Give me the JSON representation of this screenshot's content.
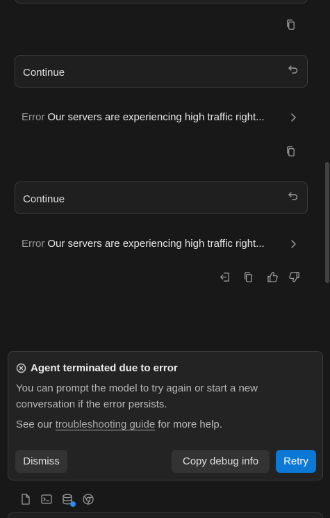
{
  "messages": [
    {
      "user_text": "Continue",
      "error_label": "Error",
      "error_text": "Our servers are experiencing high traffic right..."
    },
    {
      "user_text": "Continue",
      "error_label": "Error",
      "error_text": "Our servers are experiencing high traffic right..."
    }
  ],
  "icons": {
    "copy": "copy-icon",
    "undo": "undo-icon",
    "chevron": "chevron-right-icon",
    "export": "export-icon",
    "thumbs_up": "thumbs-up-icon",
    "thumbs_down": "thumbs-down-icon"
  },
  "error_card": {
    "title": "Agent terminated due to error",
    "body": "You can prompt the model to try again or start a new conversation if the error persists.",
    "help_prefix": "See our",
    "help_link": "troubleshooting guide",
    "help_suffix": "for more help.",
    "dismiss_label": "Dismiss",
    "copy_label": "Copy debug info",
    "retry_label": "Retry"
  },
  "colors": {
    "background": "#181818",
    "retry_accent": "#0a78d4",
    "badge_dot": "#2b8cf5"
  },
  "bottom_bar": [
    "file-icon",
    "terminal-icon",
    "database-icon",
    "chrome-icon"
  ]
}
